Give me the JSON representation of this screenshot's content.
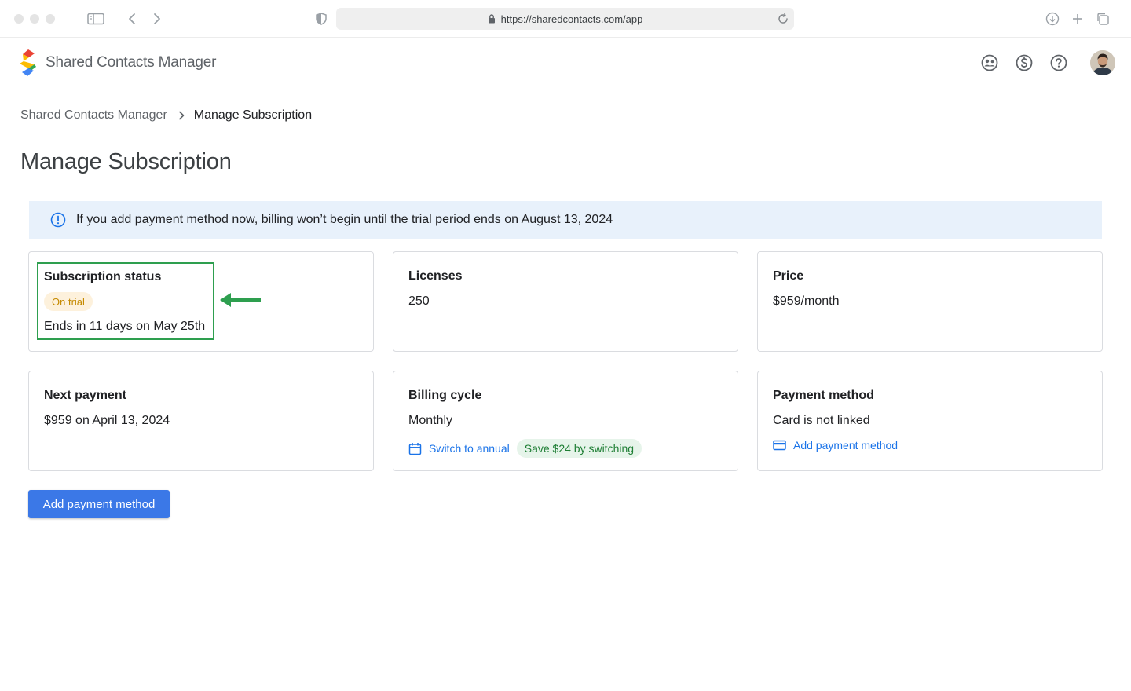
{
  "browser": {
    "url": "https://sharedcontacts.com/app"
  },
  "header": {
    "app_name": "Shared Contacts Manager",
    "icons": [
      "people-icon",
      "dollar-icon",
      "help-icon",
      "avatar"
    ]
  },
  "breadcrumb": {
    "items": [
      "Shared Contacts Manager",
      "Manage Subscription"
    ]
  },
  "page": {
    "title": "Manage Subscription"
  },
  "banner": {
    "text": "If you add payment method now, billing won’t begin until the trial period ends on August 13, 2024"
  },
  "cards": {
    "subscription_status": {
      "title": "Subscription status",
      "badge": "On trial",
      "value": "Ends in 11 days on May 25th"
    },
    "licenses": {
      "title": "Licenses",
      "value": "250"
    },
    "price": {
      "title": "Price",
      "value": "$959/month"
    },
    "next_payment": {
      "title": "Next payment",
      "value": "$959 on April 13, 2024"
    },
    "billing_cycle": {
      "title": "Billing cycle",
      "value": "Monthly",
      "action": "Switch to annual",
      "badge": "Save $24 by switching"
    },
    "payment_method": {
      "title": "Payment method",
      "value": "Card is not linked",
      "action": "Add payment method"
    }
  },
  "actions": {
    "primary_button": "Add payment method"
  },
  "colors": {
    "accent": "#1a73e8",
    "button": "#3b78e7",
    "banner_bg": "#e8f1fb",
    "trial_badge_bg": "#fdf1dc",
    "trial_badge_text": "#c58a00",
    "save_badge_bg": "#e6f4ea",
    "save_badge_text": "#1e7e34",
    "highlight": "#2e9f4f"
  }
}
